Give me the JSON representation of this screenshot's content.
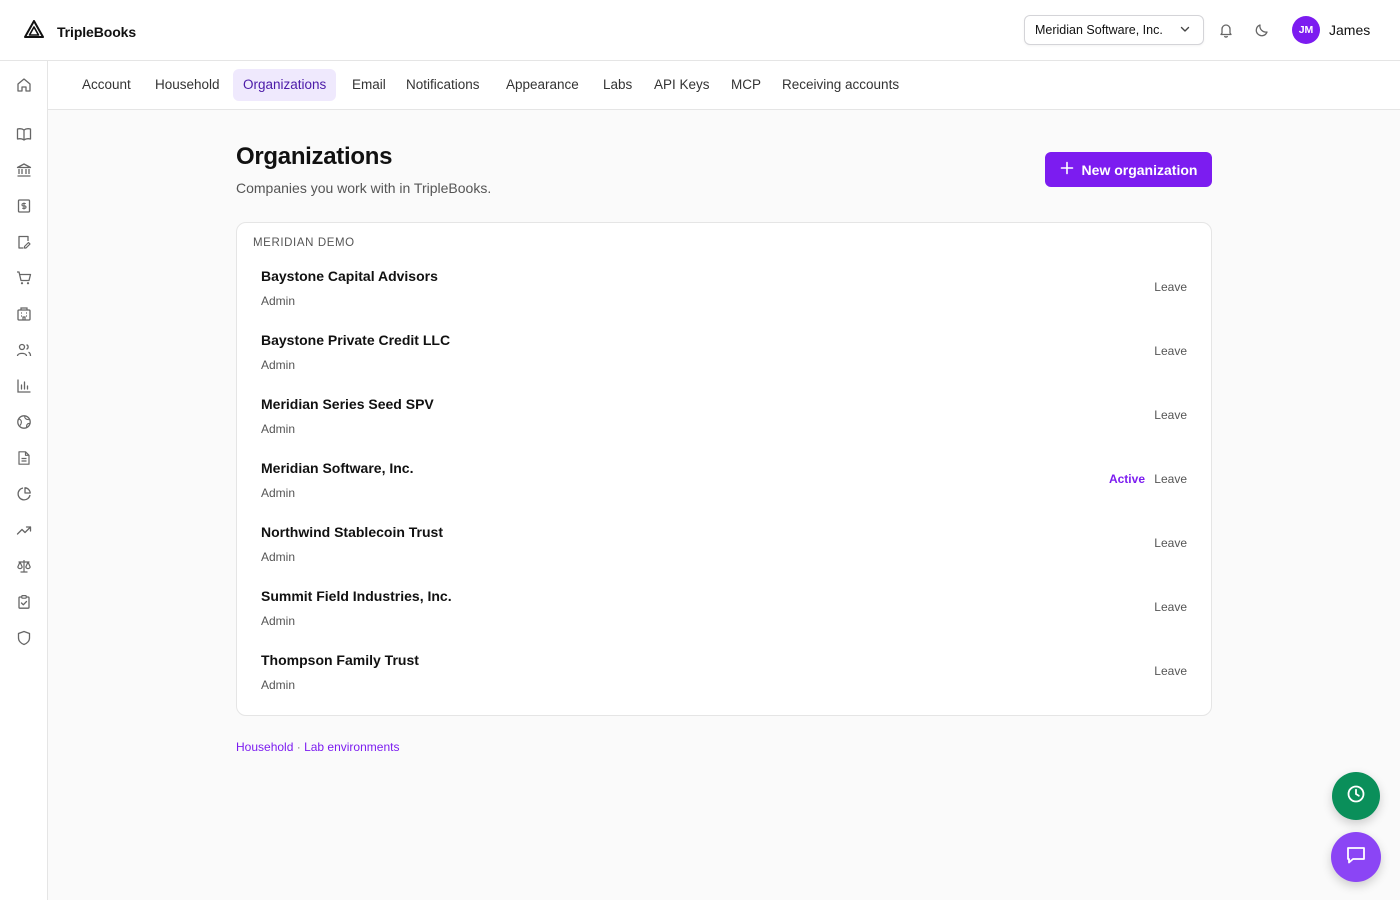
{
  "header": {
    "brand": "TripleBooks",
    "org_selector": "Meridian Software, Inc.",
    "user": {
      "initials": "JM",
      "name": "James"
    }
  },
  "sidebar": {
    "icons": [
      "home-icon",
      "book-open-icon",
      "bank-icon",
      "dollar-document-icon",
      "edit-document-icon",
      "cart-icon",
      "building-icon",
      "users-icon",
      "bar-chart-icon",
      "globe-icon",
      "file-text-icon",
      "pie-chart-icon",
      "trending-up-icon",
      "scale-icon",
      "clipboard-check-icon",
      "shield-icon"
    ]
  },
  "tabs": [
    "Account",
    "Household",
    "Organizations",
    "Email",
    "Notifications",
    "Appearance",
    "Labs",
    "API Keys",
    "MCP",
    "Receiving accounts"
  ],
  "active_tab": "Organizations",
  "main": {
    "title": "Organizations",
    "subtitle": "Companies you work with in TripleBooks.",
    "new_button": "New organization",
    "group_label": "MERIDIAN DEMO",
    "orgs": [
      {
        "name": "Baystone Capital Advisors",
        "role": "Admin",
        "active": "",
        "leave": "Leave"
      },
      {
        "name": "Baystone Private Credit LLC",
        "role": "Admin",
        "active": "",
        "leave": "Leave"
      },
      {
        "name": "Meridian Series Seed SPV",
        "role": "Admin",
        "active": "",
        "leave": "Leave"
      },
      {
        "name": "Meridian Software, Inc.",
        "role": "Admin",
        "active": "Active",
        "leave": "Leave"
      },
      {
        "name": "Northwind Stablecoin Trust",
        "role": "Admin",
        "active": "",
        "leave": "Leave"
      },
      {
        "name": "Summit Field Industries, Inc.",
        "role": "Admin",
        "active": "",
        "leave": "Leave"
      },
      {
        "name": "Thompson Family Trust",
        "role": "Admin",
        "active": "",
        "leave": "Leave"
      }
    ],
    "footer": {
      "household": "Household",
      "separator": "·",
      "labs": "Lab environments"
    }
  },
  "colors": {
    "accent": "#7c1cf0",
    "clock_fab": "#0a8f5a",
    "chat_fab": "#8b45f5"
  }
}
